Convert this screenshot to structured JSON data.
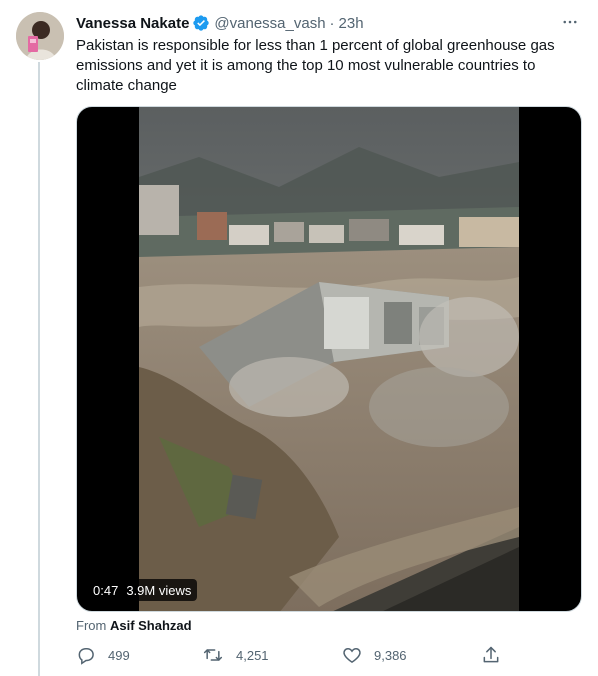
{
  "author": {
    "name": "Vanessa Nakate",
    "handle": "@vanessa_vash",
    "separator": "·",
    "time": "23h"
  },
  "tweet": {
    "text": "Pakistan is responsible for less than 1 percent of global greenhouse gas emissions and yet it is among the top 10 most vulnerable countries to climate change"
  },
  "media": {
    "duration": "0:47",
    "views": "3.9M views"
  },
  "attribution": {
    "prefix": "From",
    "source": "Asif Shahzad"
  },
  "actions": {
    "replies": "499",
    "retweets": "4,251",
    "likes": "9,386"
  },
  "colors": {
    "verified": "#1d9bf0",
    "secondary_text": "#536471",
    "primary_text": "#0f1419"
  },
  "icons": [
    "verified-badge-icon",
    "more-icon",
    "reply-icon",
    "retweet-icon",
    "like-icon",
    "share-icon"
  ]
}
